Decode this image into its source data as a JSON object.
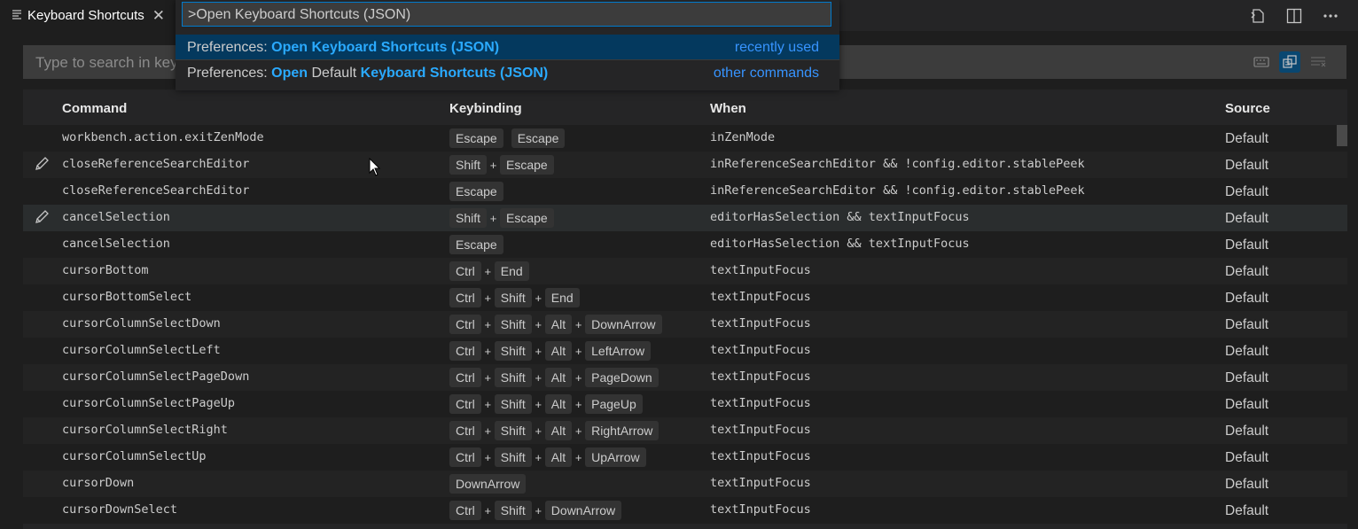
{
  "tab": {
    "title": "Keyboard Shortcuts",
    "icon": "list-icon",
    "close_glyph": "✕"
  },
  "search": {
    "placeholder": "Type to search in keybindings"
  },
  "columns": {
    "command": "Command",
    "keybinding": "Keybinding",
    "when": "When",
    "source": "Source"
  },
  "quickpick": {
    "value": ">Open Keyboard Shortcuts (JSON)",
    "items": [
      {
        "segments": [
          {
            "text": "Preferences: ",
            "hl": false
          },
          {
            "text": "Open Keyboard Shortcuts (JSON)",
            "hl": true
          }
        ],
        "description": "recently used",
        "selected": true
      },
      {
        "segments": [
          {
            "text": "Preferences: ",
            "hl": false
          },
          {
            "text": "Open",
            "hl": true
          },
          {
            "text": " Default ",
            "hl": false
          },
          {
            "text": "Keyboard Shortcuts (JSON)",
            "hl": true
          }
        ],
        "description": "other commands",
        "selected": false
      }
    ]
  },
  "rows": [
    {
      "command": "workbench.action.exitZenMode",
      "chords": [
        [
          "Escape"
        ],
        [
          "Escape"
        ]
      ],
      "when": "inZenMode",
      "source": "Default",
      "edit_icon": false
    },
    {
      "command": "closeReferenceSearchEditor",
      "chords": [
        [
          "Shift",
          "Escape"
        ]
      ],
      "when": "inReferenceSearchEditor && !config.editor.stablePeek",
      "source": "Default",
      "edit_icon": true
    },
    {
      "command": "closeReferenceSearchEditor",
      "chords": [
        [
          "Escape"
        ]
      ],
      "when": "inReferenceSearchEditor && !config.editor.stablePeek",
      "source": "Default",
      "edit_icon": false
    },
    {
      "command": "cancelSelection",
      "chords": [
        [
          "Shift",
          "Escape"
        ]
      ],
      "when": "editorHasSelection && textInputFocus",
      "source": "Default",
      "edit_icon": true,
      "hover": true
    },
    {
      "command": "cancelSelection",
      "chords": [
        [
          "Escape"
        ]
      ],
      "when": "editorHasSelection && textInputFocus",
      "source": "Default",
      "edit_icon": false
    },
    {
      "command": "cursorBottom",
      "chords": [
        [
          "Ctrl",
          "End"
        ]
      ],
      "when": "textInputFocus",
      "source": "Default",
      "edit_icon": false
    },
    {
      "command": "cursorBottomSelect",
      "chords": [
        [
          "Ctrl",
          "Shift",
          "End"
        ]
      ],
      "when": "textInputFocus",
      "source": "Default",
      "edit_icon": false
    },
    {
      "command": "cursorColumnSelectDown",
      "chords": [
        [
          "Ctrl",
          "Shift",
          "Alt",
          "DownArrow"
        ]
      ],
      "when": "textInputFocus",
      "source": "Default",
      "edit_icon": false
    },
    {
      "command": "cursorColumnSelectLeft",
      "chords": [
        [
          "Ctrl",
          "Shift",
          "Alt",
          "LeftArrow"
        ]
      ],
      "when": "textInputFocus",
      "source": "Default",
      "edit_icon": false
    },
    {
      "command": "cursorColumnSelectPageDown",
      "chords": [
        [
          "Ctrl",
          "Shift",
          "Alt",
          "PageDown"
        ]
      ],
      "when": "textInputFocus",
      "source": "Default",
      "edit_icon": false
    },
    {
      "command": "cursorColumnSelectPageUp",
      "chords": [
        [
          "Ctrl",
          "Shift",
          "Alt",
          "PageUp"
        ]
      ],
      "when": "textInputFocus",
      "source": "Default",
      "edit_icon": false
    },
    {
      "command": "cursorColumnSelectRight",
      "chords": [
        [
          "Ctrl",
          "Shift",
          "Alt",
          "RightArrow"
        ]
      ],
      "when": "textInputFocus",
      "source": "Default",
      "edit_icon": false
    },
    {
      "command": "cursorColumnSelectUp",
      "chords": [
        [
          "Ctrl",
          "Shift",
          "Alt",
          "UpArrow"
        ]
      ],
      "when": "textInputFocus",
      "source": "Default",
      "edit_icon": false
    },
    {
      "command": "cursorDown",
      "chords": [
        [
          "DownArrow"
        ]
      ],
      "when": "textInputFocus",
      "source": "Default",
      "edit_icon": false
    },
    {
      "command": "cursorDownSelect",
      "chords": [
        [
          "Ctrl",
          "Shift",
          "DownArrow"
        ]
      ],
      "when": "textInputFocus",
      "source": "Default",
      "edit_icon": false
    }
  ],
  "plus_glyph": "+",
  "icons": [
    "list-icon",
    "close-icon",
    "open-json-icon",
    "split-editor-icon",
    "more-actions-icon",
    "keyboard-icon",
    "sort-precedence-icon",
    "clear-search-icon",
    "edit-icon",
    "mouse-cursor-icon"
  ],
  "colors": {
    "accent": "#007acc",
    "highlight": "#2aaaff",
    "description": "#3794ff",
    "selected_item": "#04395e"
  }
}
